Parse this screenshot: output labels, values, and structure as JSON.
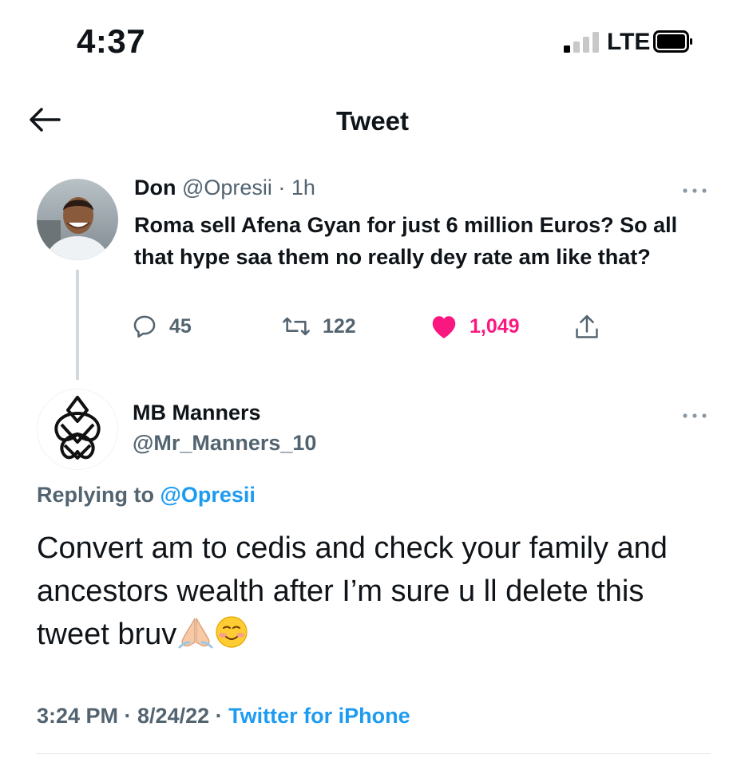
{
  "status_bar": {
    "time": "4:37",
    "network": "LTE",
    "signal_bars_active": 1,
    "signal_bars_total": 4
  },
  "header": {
    "title": "Tweet",
    "back_icon": "arrow-left-icon"
  },
  "parent_tweet": {
    "display_name": "Don",
    "meta": " @Opresii · 1h",
    "text": "Roma sell Afena Gyan for just 6 million Euros? So all that hype saa them no really dey rate am like that?",
    "reply_count": "45",
    "retweet_count": "122",
    "like_count": "1,049",
    "liked": true
  },
  "reply_tweet": {
    "display_name": "MB Manners",
    "handle": "@Mr_Manners_10",
    "replying_label": "Replying to ",
    "replying_to": "@Opresii",
    "text": "Convert am to cedis and check your family and ancestors wealth after I’m sure u ll delete this  tweet bruv",
    "emojis": [
      "folded-hands-emoji",
      "smiling-face-emoji"
    ],
    "timestamp": "3:24 PM · 8/24/22 · ",
    "source": "Twitter for iPhone"
  },
  "colors": {
    "accent": "#1d9bf0",
    "like": "#f91880",
    "secondary_text": "#536471",
    "primary_text": "#0f1419"
  }
}
